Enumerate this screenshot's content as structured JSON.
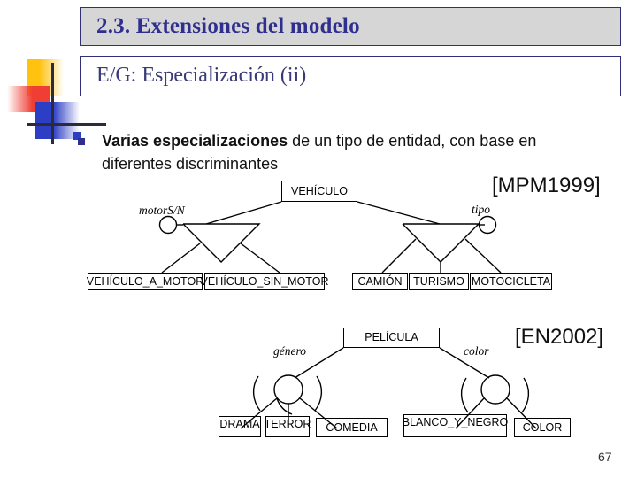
{
  "slide": {
    "title": "2.3. Extensiones del modelo",
    "subtitle": "E/G: Especialización (ii)",
    "page_number": "67",
    "colors": {
      "title_text": "#2f2f8f",
      "title_bg": "#d6d6d6",
      "border": "#2f2f7a",
      "subtitle_text": "#3a3a78",
      "deco_yellow": "#ffc20e",
      "deco_red": "#ef3e33",
      "deco_blue": "#2c3ec4",
      "deco_cross": "#2b2b3c"
    }
  },
  "bullet": {
    "strong": "Varias especializaciones",
    "rest": " de un tipo de entidad, con base en diferentes discriminantes"
  },
  "citations": {
    "mpm": "[MPM1999]",
    "en": "[EN2002]"
  },
  "diagram_vehiculo": {
    "superclass": "VEHÍCULO",
    "discriminators": [
      {
        "label": "motorS/N"
      },
      {
        "label": "tipo"
      }
    ],
    "subclasses_left": [
      "VEHÍCULO_A_MOTOR",
      "VEHÍCULO_SIN_MOTOR"
    ],
    "subclasses_right": [
      "CAMIÓN",
      "TURISMO",
      "MOTOCICLETA"
    ]
  },
  "diagram_pelicula": {
    "superclass": "PELÍCULA",
    "discriminators": [
      {
        "label": "género"
      },
      {
        "label": "color"
      }
    ],
    "subclasses_left": [
      "DRAMA",
      "TERROR",
      "COMEDIA"
    ],
    "subclasses_right": [
      "BLANCO_Y_NEGRO",
      "COLOR"
    ]
  }
}
